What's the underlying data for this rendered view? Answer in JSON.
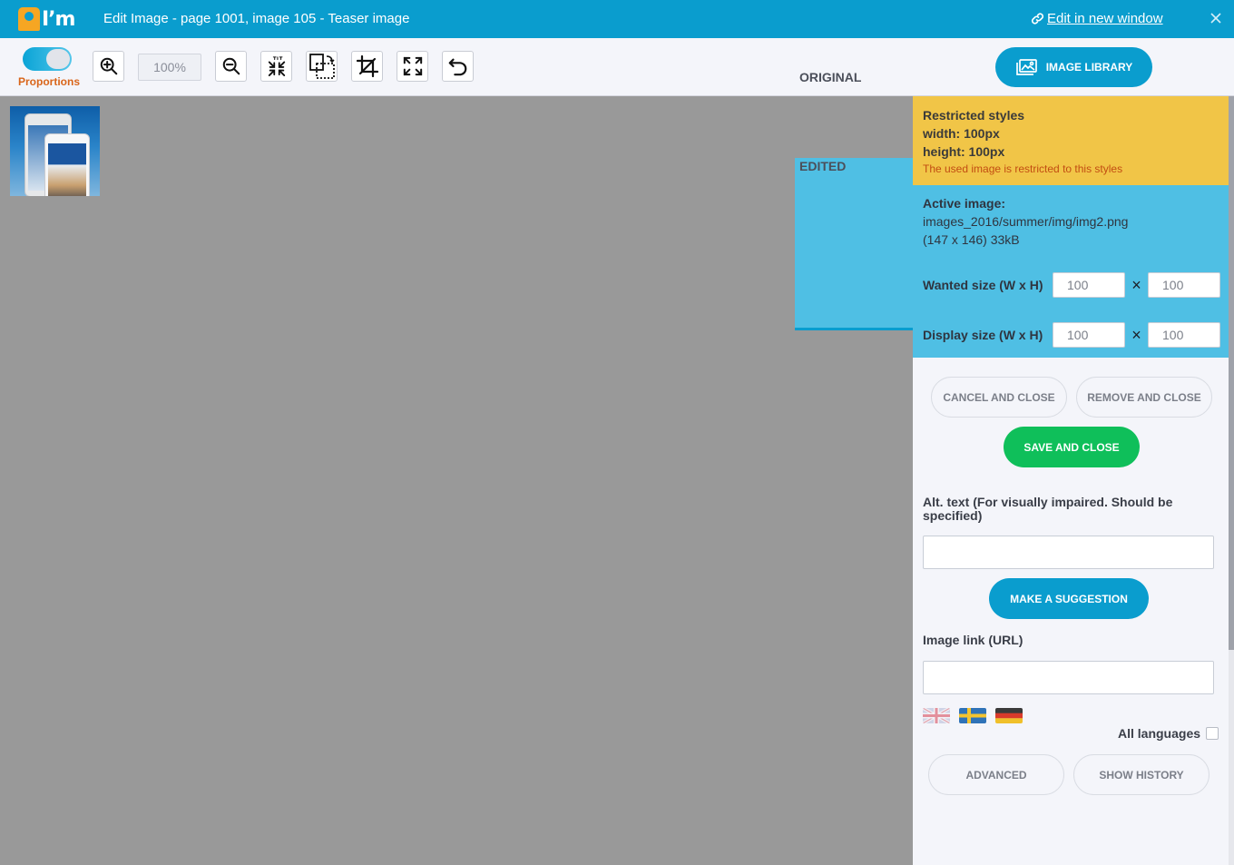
{
  "app": {
    "logo_text": "I’m",
    "window_title": "Edit Image - page 1001, image 105 - Teaser image",
    "edit_link": "Edit in new window"
  },
  "toolbar": {
    "proportions_label": "Proportions",
    "proportions_on": true,
    "zoom_value": "100%",
    "tools": [
      "zoom-in-icon",
      "zoom-out-icon",
      "fit-icon",
      "resize-canvas-icon",
      "crop-icon",
      "fullscreen-icon",
      "undo-icon"
    ],
    "tabs": [
      {
        "label": "EDITED",
        "active": true
      },
      {
        "label": "ORIGINAL",
        "active": false
      }
    ],
    "image_library_label": "IMAGE LIBRARY"
  },
  "restricted": {
    "title": "Restricted styles",
    "width": "width: 100px",
    "height": "height: 100px",
    "note": "The used image is restricted to this styles"
  },
  "active_image": {
    "label": "Active image:",
    "path": "images_2016/summer/img/img2.png",
    "meta": "(147 x 146) 33kB",
    "wanted_label": "Wanted size (W x H)",
    "wanted_w": "100",
    "wanted_h": "100",
    "display_label": "Display size (W x H)",
    "display_w": "100",
    "display_h": "100",
    "times": "×"
  },
  "actions": {
    "cancel": "CANCEL AND CLOSE",
    "remove": "REMOVE AND CLOSE",
    "save": "SAVE AND CLOSE",
    "alt_label": "Alt. text (For visually impaired. Should be specified)",
    "suggest": "MAKE A SUGGESTION",
    "link_label": "Image link (URL)",
    "languages": [
      "english-flag-icon",
      "swedish-flag-icon",
      "german-flag-icon"
    ],
    "all_languages": "All languages",
    "advanced": "ADVANCED",
    "history": "SHOW HISTORY"
  },
  "colors": {
    "brand_blue": "#0a9dce",
    "restricted_bg": "#f1c547",
    "active_bg": "#4fbfe4",
    "save_green": "#0fbf5a",
    "warning_text": "#c24d12",
    "canvas_gray": "#999999"
  }
}
